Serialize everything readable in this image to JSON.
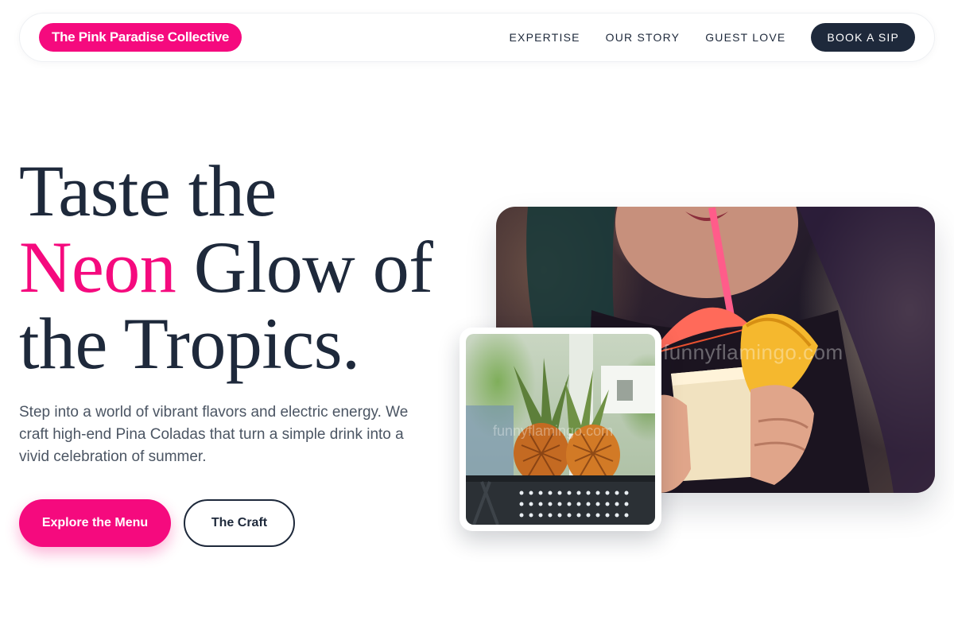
{
  "nav": {
    "brand": "The Pink Paradise Collective",
    "links": [
      "EXPERTISE",
      "OUR STORY",
      "GUEST LOVE"
    ],
    "cta": "BOOK A SIP"
  },
  "hero": {
    "title_line1": "Taste the",
    "title_accent": "Neon",
    "title_rest_line2": " Glow of",
    "title_line3": "the Tropics.",
    "description": "Step into a world of vibrant flavors and electric energy. We craft high-end Pina Coladas that turn a simple drink into a vivid celebration of summer.",
    "primary_button": "Explore the Menu",
    "secondary_button": "The Craft"
  },
  "images": {
    "main_watermark": "funnyflamingo.com",
    "small_watermark": "funnyflamingo.com"
  },
  "colors": {
    "accent": "#f50a7e",
    "dark": "#1e293b"
  }
}
